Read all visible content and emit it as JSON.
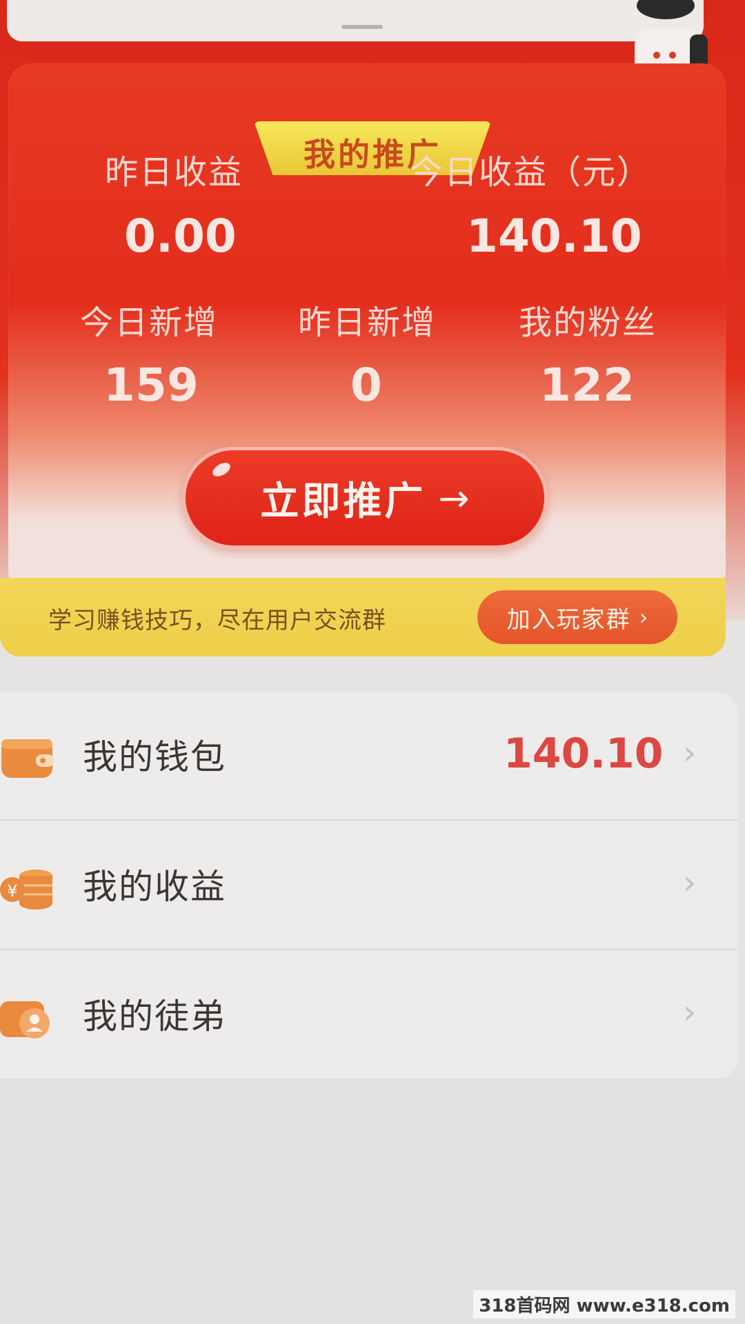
{
  "top_strip": {
    "text": ""
  },
  "promo": {
    "tag": "我的推广",
    "yesterday_earnings_label": "昨日收益",
    "today_earnings_label": "今日收益（元）",
    "yesterday_earnings_value": "0.00",
    "today_earnings_value": "140.10",
    "today_new_label": "今日新增",
    "yesterday_new_label": "昨日新增",
    "fans_label": "我的粉丝",
    "today_new_value": "159",
    "yesterday_new_value": "0",
    "fans_value": "122",
    "promote_button": "立即推广",
    "promote_arrow": "→"
  },
  "banner": {
    "text": "学习赚钱技巧，尽在用户交流群",
    "join_button": "加入玩家群",
    "join_chevron": "›"
  },
  "list": [
    {
      "label": "我的钱包",
      "value": "140.10",
      "icon": "wallet-icon"
    },
    {
      "label": "我的收益",
      "value": "",
      "icon": "coins-icon"
    },
    {
      "label": "我的徒弟",
      "value": "",
      "icon": "disciple-icon"
    }
  ],
  "chevron": "›",
  "watermark": "318首码网 www.e318.com",
  "colors": {
    "brand_red": "#e42d1c",
    "banner_yellow": "#eecf4a",
    "join_orange": "#e4552a",
    "wallet_value_red": "#dc4742"
  }
}
